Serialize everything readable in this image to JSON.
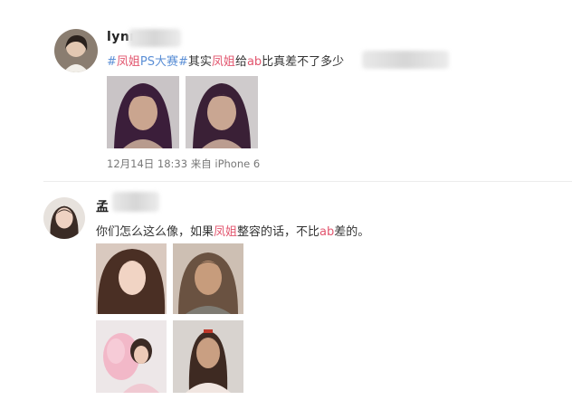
{
  "post1": {
    "username": "lynn",
    "tag_open": "#",
    "tag_name_hl": "凤姐",
    "tag_name_rest": "PS大赛#",
    "text_a": "其实",
    "text_hl1": "凤姐",
    "text_b": "给",
    "text_hl2": "ab",
    "text_c": "比真差不了多少",
    "timestamp": "12月14日 18:33 来自 iPhone 6"
  },
  "post2": {
    "username": "孟",
    "text_a": "你们怎么这么像，如果",
    "text_hl1": "凤姐",
    "text_b": "整容的话，不比",
    "text_hl2": "ab",
    "text_c": "差的。"
  }
}
